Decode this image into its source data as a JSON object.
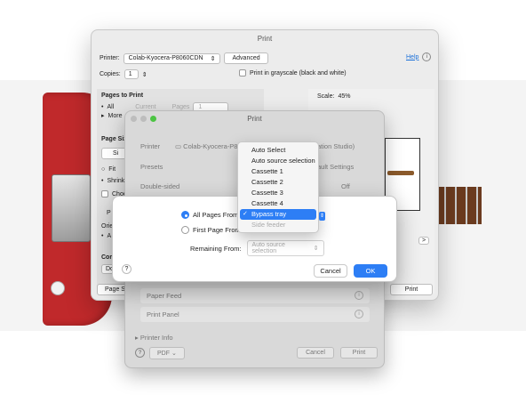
{
  "print_dialog": {
    "title": "Print",
    "printer_label": "Printer:",
    "printer_value": "Colab-Kyocera-P8060CDN",
    "advanced_button": "Advanced",
    "help_link": "Help",
    "info_icon": "info-icon",
    "copies_label": "Copies:",
    "copies_value": "1",
    "grayscale_label": "Print in grayscale (black and white)",
    "pages_to_print_heading": "Pages to Print",
    "pages_all": "All",
    "pages_current": "Current",
    "pages_range": "Pages",
    "pages_range_value": "1",
    "more_label": "More",
    "page_size_heading": "Page Siz",
    "page_size_btn": "Si",
    "fit_label": "Fit",
    "shrink_label": "Shrink",
    "choose_label": "Choo",
    "orient_label": "Orie",
    "auto_label": "A",
    "p_label": "P",
    "comments_heading": "Com",
    "do_label": "Do",
    "scale_label": "Scale:",
    "scale_value": "45%",
    "page_setup_button": "Page Se",
    "print_button": "Print",
    "nav_next": ">"
  },
  "sheet": {
    "title": "Print",
    "printer_label": "Printer",
    "printer_value": "Colab-Kyocera-P8",
    "printer_suffix": "ation Studio)",
    "presets_label": "Presets",
    "presets_suffix": "ault Settings",
    "double_sided_label": "Double-sided",
    "double_sided_value": "Off",
    "paper_feed": "Paper Feed",
    "print_panel": "Print Panel",
    "printer_info": "Printer Info",
    "help": "?",
    "pdf_button": "PDF",
    "cancel_button": "Cancel",
    "print_button": "Print"
  },
  "dialog": {
    "all_pages_label": "All Pages From:",
    "first_page_label": "First Page From:",
    "remaining_label": "Remaining From:",
    "remaining_value": "Auto source selection",
    "help": "?",
    "cancel_button": "Cancel",
    "ok_button": "OK"
  },
  "menu": {
    "items": [
      {
        "label": "Auto Select",
        "state": "normal"
      },
      {
        "label": "Auto source selection",
        "state": "normal"
      },
      {
        "label": "Cassette 1",
        "state": "normal"
      },
      {
        "label": "Cassette 2",
        "state": "normal"
      },
      {
        "label": "Cassette 3",
        "state": "normal"
      },
      {
        "label": "Cassette 4",
        "state": "normal"
      },
      {
        "label": "Bypass tray",
        "state": "selected"
      },
      {
        "label": "Side feeder",
        "state": "disabled"
      }
    ],
    "checkmark": "✓"
  },
  "colors": {
    "accent": "#2d7ef5",
    "guitar_red": "#c0292b"
  }
}
